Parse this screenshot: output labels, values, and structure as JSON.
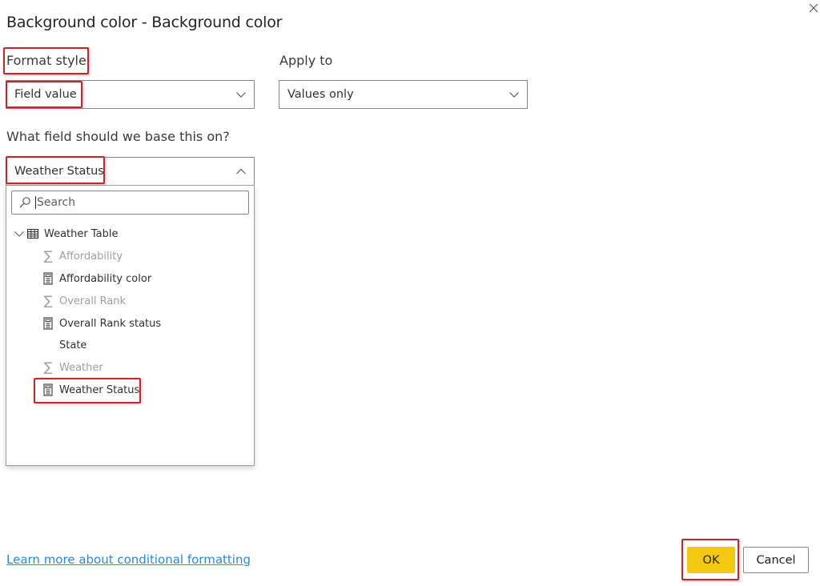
{
  "dialog": {
    "title": "Background color - Background color",
    "close_icon": "close-icon"
  },
  "format_style": {
    "label": "Format style",
    "value": "Field value"
  },
  "apply_to": {
    "label": "Apply to",
    "value": "Values only"
  },
  "base_field": {
    "label": "What field should we base this on?",
    "value": "Weather Status",
    "expanded": true,
    "search": {
      "placeholder": "Search",
      "icon": "search-icon"
    },
    "tree": {
      "table_name": "Weather Table",
      "table_icon": "table-icon",
      "items": [
        {
          "label": "Affordability",
          "icon": "sigma-icon",
          "enabled": false
        },
        {
          "label": "Affordability color",
          "icon": "calculator-icon",
          "enabled": true
        },
        {
          "label": "Overall Rank",
          "icon": "sigma-icon",
          "enabled": false
        },
        {
          "label": "Overall Rank status",
          "icon": "calculator-icon",
          "enabled": true
        },
        {
          "label": "State",
          "icon": "",
          "enabled": true
        },
        {
          "label": "Weather",
          "icon": "sigma-icon",
          "enabled": false
        },
        {
          "label": "Weather Status",
          "icon": "calculator-icon",
          "enabled": true,
          "selected": true
        }
      ]
    }
  },
  "footer": {
    "learn_more": "Learn more about conditional formatting",
    "ok_label": "OK",
    "cancel_label": "Cancel"
  },
  "colors": {
    "ok_button": "#f2c811",
    "highlight_border": "#c4262e",
    "link": "#2b88d8",
    "disabled_text": "#a19f9d"
  }
}
